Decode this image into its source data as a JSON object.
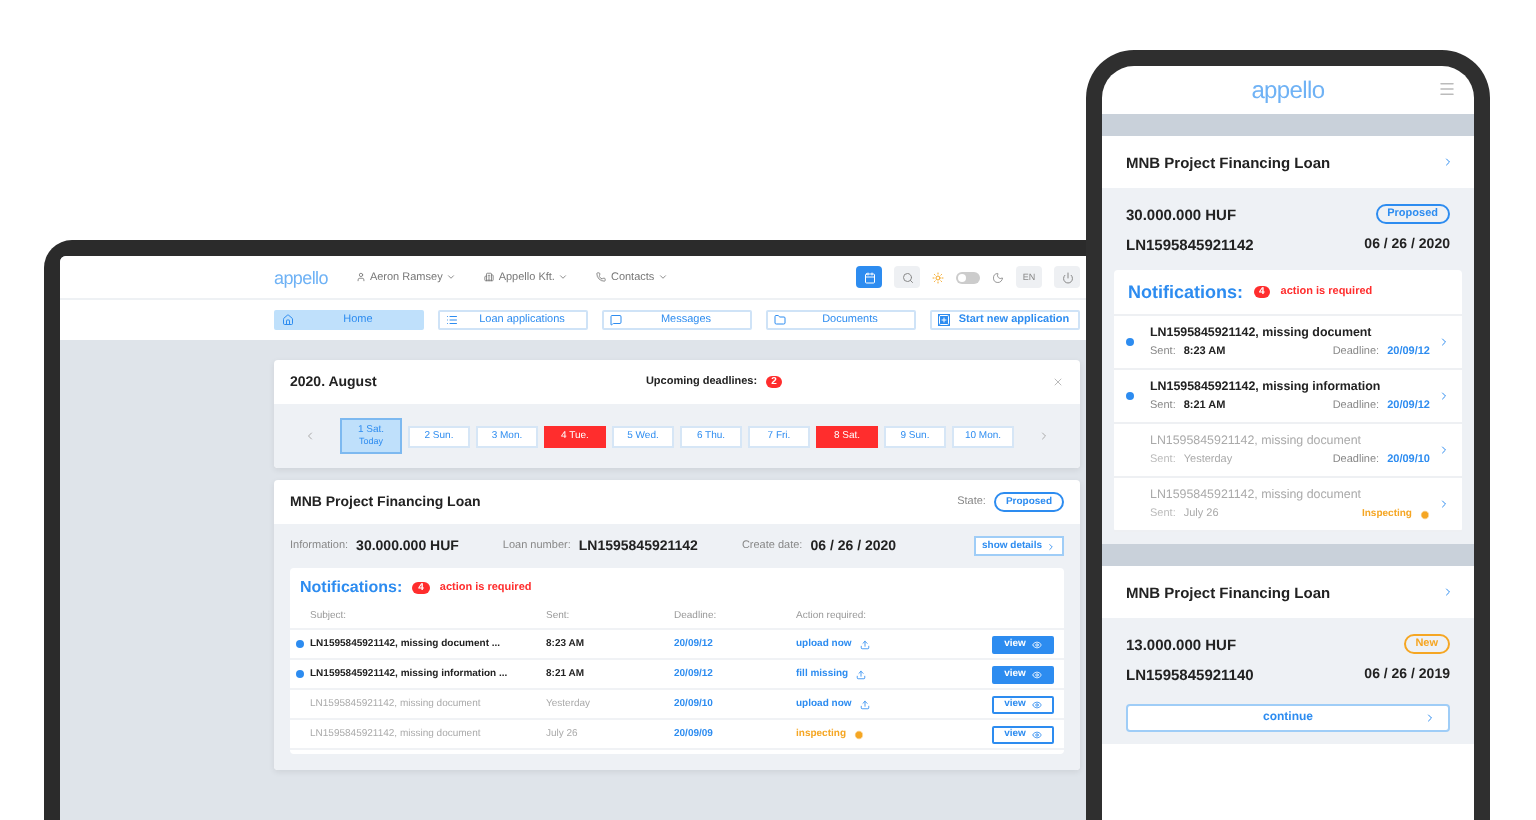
{
  "laptop": {
    "header": {
      "logo": "appello",
      "user": "Aeron Ramsey",
      "company": "Appello Kft.",
      "contacts": "Contacts",
      "language": "EN",
      "dark_mode": false
    },
    "nav": [
      {
        "label": "Home",
        "selected": true,
        "kind": "link"
      },
      {
        "label": "Loan applications",
        "selected": false,
        "kind": "link"
      },
      {
        "label": "Messages",
        "selected": false,
        "kind": "link"
      },
      {
        "label": "Documents",
        "selected": false,
        "kind": "link"
      },
      {
        "label": "Start new application",
        "selected": false,
        "kind": "primary"
      }
    ],
    "calendar": {
      "title": "2020. August",
      "deadlines_label": "Upcoming deadlines:",
      "deadlines_count": "2",
      "days": [
        {
          "label": "1 Sat.",
          "sublabel": "Today",
          "selected": true,
          "deadline": false
        },
        {
          "label": "2 Sun.",
          "selected": false,
          "deadline": false
        },
        {
          "label": "3 Mon.",
          "selected": false,
          "deadline": false
        },
        {
          "label": "4 Tue.",
          "selected": false,
          "deadline": true
        },
        {
          "label": "5 Wed.",
          "selected": false,
          "deadline": false
        },
        {
          "label": "6 Thu.",
          "selected": false,
          "deadline": false
        },
        {
          "label": "7 Fri.",
          "selected": false,
          "deadline": false
        },
        {
          "label": "8 Sat.",
          "selected": false,
          "deadline": true
        },
        {
          "label": "9 Sun.",
          "selected": false,
          "deadline": false
        },
        {
          "label": "10 Mon.",
          "selected": false,
          "deadline": false
        }
      ]
    },
    "loan": {
      "title": "MNB Project Financing Loan",
      "state_label": "State:",
      "state": {
        "text": "Proposed",
        "color": "#2d8cf0"
      },
      "information_label": "Information:",
      "amount": "30.000.000 HUF",
      "number_label": "Loan number:",
      "number": "LN1595845921142",
      "date_label": "Create date:",
      "date": "06 / 26 / 2020",
      "details_button": "show details",
      "notifications": {
        "title": "Notifications:",
        "count": "4",
        "message": "action is required",
        "columns": [
          "Subject:",
          "Sent:",
          "Deadline:",
          "Action required:"
        ],
        "rows": [
          {
            "subject": "LN1595845921142, missing document ...",
            "sent": "8:23 AM",
            "deadline": "20/09/12",
            "action": "upload now",
            "kind": "upload",
            "button": "view",
            "unread": true
          },
          {
            "subject": "LN1595845921142, missing information ...",
            "sent": "8:21 AM",
            "deadline": "20/09/12",
            "action": "fill missing",
            "kind": "upload",
            "button": "view",
            "unread": true
          },
          {
            "subject": "LN1595845921142, missing document",
            "sent": "Yesterday",
            "deadline": "20/09/10",
            "action": "upload now",
            "kind": "upload",
            "button": "view",
            "unread": false
          },
          {
            "subject": "LN1595845921142, missing document",
            "sent": "July 26",
            "deadline": "20/09/09",
            "action": "inspecting",
            "kind": "inspecting",
            "button": "view",
            "unread": false
          }
        ]
      }
    }
  },
  "phone": {
    "logo": "appello",
    "loans": [
      {
        "title": "MNB Project Financing Loan",
        "amount": "30.000.000 HUF",
        "state": {
          "text": "Proposed",
          "color": "#2d8cf0"
        },
        "number": "LN1595845921142",
        "date": "06 / 26 / 2020",
        "notifications": {
          "title": "Notifications:",
          "count": "4",
          "message": "action is required",
          "rows": [
            {
              "subject": "LN1595845921142, missing document",
              "sent_label": "Sent:",
              "sent": "8:23 AM",
              "deadline_label": "Deadline:",
              "deadline": "20/09/12",
              "unread": true
            },
            {
              "subject": "LN1595845921142, missing information",
              "sent_label": "Sent:",
              "sent": "8:21 AM",
              "deadline_label": "Deadline:",
              "deadline": "20/09/12",
              "unread": true
            },
            {
              "subject": "LN1595845921142, missing document",
              "sent_label": "Sent:",
              "sent": "Yesterday",
              "deadline_label": "Deadline:",
              "deadline": "20/09/10",
              "unread": false
            },
            {
              "subject": "LN1595845921142, missing document",
              "sent_label": "Sent:",
              "sent": "July 26",
              "status": "Inspecting",
              "unread": false
            }
          ]
        }
      },
      {
        "title": "MNB Project Financing Loan",
        "amount": "13.000.000 HUF",
        "state": {
          "text": "New",
          "color": "#f5a623"
        },
        "number": "LN1595845921140",
        "date": "06 / 26 / 2019",
        "button": "continue"
      }
    ]
  }
}
